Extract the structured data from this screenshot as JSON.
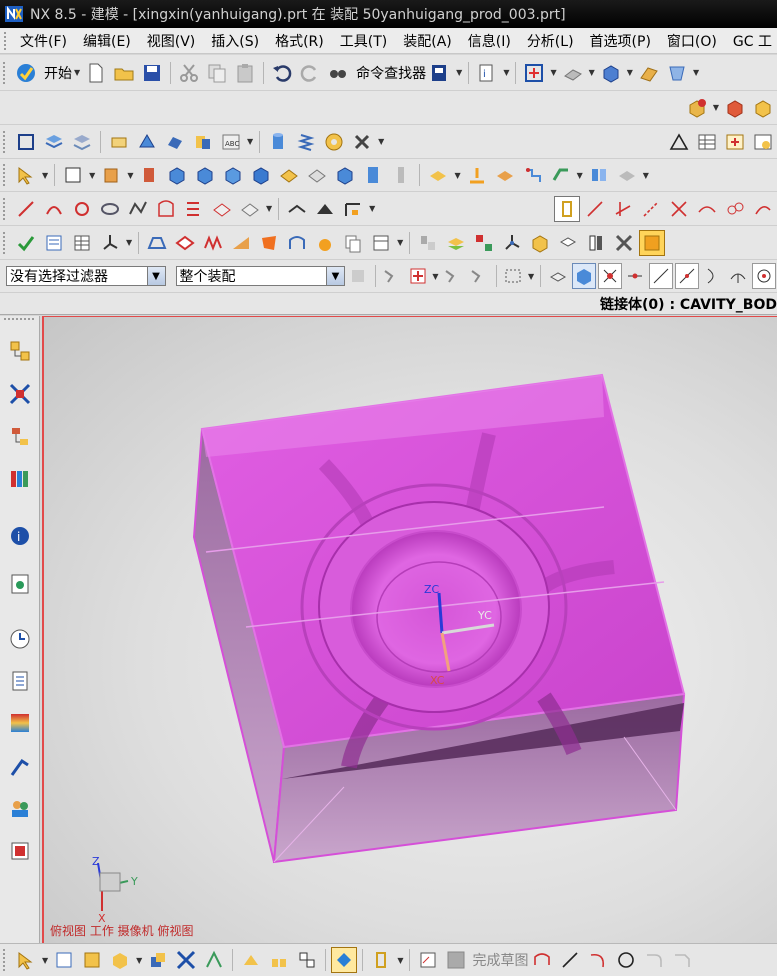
{
  "titlebar": {
    "title": "NX 8.5 - 建模 - [xingxin(yanhuigang).prt 在 装配 50yanhuigang_prod_003.prt]"
  },
  "menu": {
    "items": [
      "文件(F)",
      "编辑(E)",
      "视图(V)",
      "插入(S)",
      "格式(R)",
      "工具(T)",
      "装配(A)",
      "信息(I)",
      "分析(L)",
      "首选项(P)",
      "窗口(O)",
      "GC 工"
    ]
  },
  "standard_toolbar": {
    "start_label": "开始",
    "command_finder_label": "命令查找器"
  },
  "selection_bar": {
    "filter_value": "没有选择过滤器",
    "scope_value": "整个装配"
  },
  "status": {
    "text": "链接体(0) : CAVITY_BOD"
  },
  "viewport": {
    "view_label": "俯视图 工作 摄像机 俯视图",
    "csys": {
      "zc": "ZC",
      "yc": "YC",
      "xc": "XC"
    },
    "triad": {
      "z": "Z",
      "y": "Y",
      "x": "X"
    },
    "model_color": "#d54fd8"
  },
  "bottom_toolbar": {
    "finish_sketch_label": "完成草图"
  },
  "colors": {
    "title_bg": "#000000",
    "toolbar_bg": "#e6e6e6",
    "view_border": "#e24a4a",
    "view_label": "#c02a2a"
  }
}
